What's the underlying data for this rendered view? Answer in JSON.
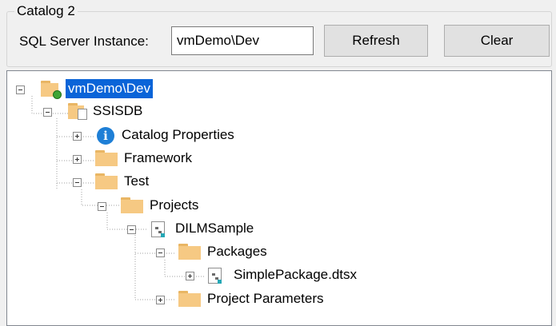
{
  "catalog": {
    "group_title": "Catalog 2",
    "instance_label": "SQL Server Instance:",
    "instance_value": "vmDemo\\Dev",
    "refresh_label": "Refresh",
    "clear_label": "Clear"
  },
  "tree": {
    "server": {
      "label": "vmDemo\\Dev",
      "icon": "server-folder-icon"
    },
    "ssisdb": {
      "label": "SSISDB",
      "icon": "database-icon"
    },
    "catalog_properties": {
      "label": "Catalog Properties",
      "icon": "info-icon"
    },
    "framework": {
      "label": "Framework",
      "icon": "folder-icon"
    },
    "test": {
      "label": "Test",
      "icon": "folder-icon"
    },
    "projects": {
      "label": "Projects",
      "icon": "folder-icon"
    },
    "dilmsample": {
      "label": "DILMSample",
      "icon": "project-icon"
    },
    "packages": {
      "label": "Packages",
      "icon": "folder-icon"
    },
    "simplepackage": {
      "label": "SimplePackage.dtsx",
      "icon": "package-icon"
    },
    "project_parameters": {
      "label": "Project Parameters",
      "icon": "folder-icon"
    }
  },
  "colors": {
    "selection": "#0a64d8",
    "folder": "#f6c983",
    "info": "#1e7fd6"
  }
}
